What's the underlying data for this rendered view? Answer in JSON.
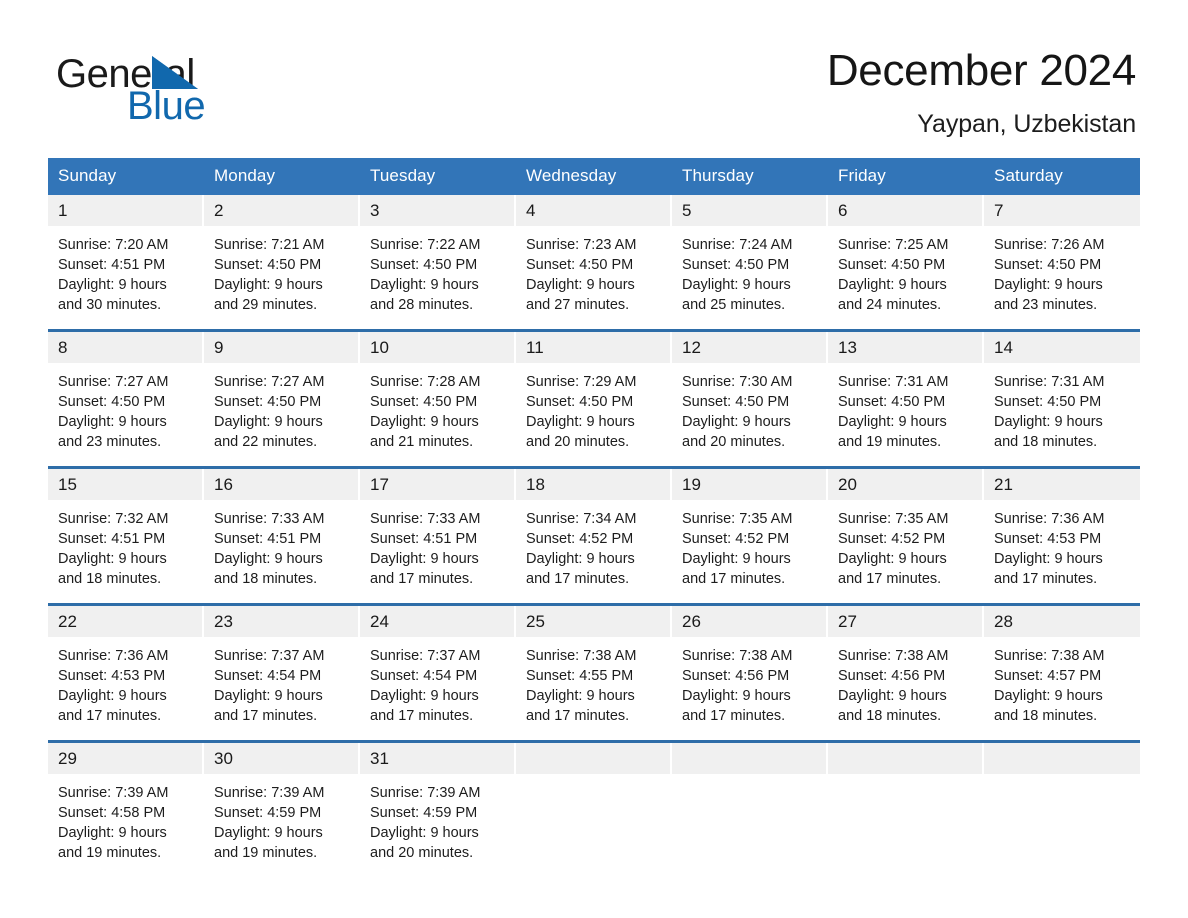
{
  "brand": {
    "name_part1": "General",
    "name_part2": "Blue",
    "triangle_color": "#1168ad",
    "accent_color": "#3275b8"
  },
  "header": {
    "month_title": "December 2024",
    "location": "Yaypan, Uzbekistan"
  },
  "calendar": {
    "weekday_headers": [
      "Sunday",
      "Monday",
      "Tuesday",
      "Wednesday",
      "Thursday",
      "Friday",
      "Saturday"
    ],
    "header_bg": "#3275b8",
    "row_divider_color": "#2e6da8",
    "day_band_bg": "#f0f0f0",
    "weeks": [
      [
        {
          "day": "1",
          "sunrise": "Sunrise: 7:20 AM",
          "sunset": "Sunset: 4:51 PM",
          "daylight_line1": "Daylight: 9 hours",
          "daylight_line2": "and 30 minutes."
        },
        {
          "day": "2",
          "sunrise": "Sunrise: 7:21 AM",
          "sunset": "Sunset: 4:50 PM",
          "daylight_line1": "Daylight: 9 hours",
          "daylight_line2": "and 29 minutes."
        },
        {
          "day": "3",
          "sunrise": "Sunrise: 7:22 AM",
          "sunset": "Sunset: 4:50 PM",
          "daylight_line1": "Daylight: 9 hours",
          "daylight_line2": "and 28 minutes."
        },
        {
          "day": "4",
          "sunrise": "Sunrise: 7:23 AM",
          "sunset": "Sunset: 4:50 PM",
          "daylight_line1": "Daylight: 9 hours",
          "daylight_line2": "and 27 minutes."
        },
        {
          "day": "5",
          "sunrise": "Sunrise: 7:24 AM",
          "sunset": "Sunset: 4:50 PM",
          "daylight_line1": "Daylight: 9 hours",
          "daylight_line2": "and 25 minutes."
        },
        {
          "day": "6",
          "sunrise": "Sunrise: 7:25 AM",
          "sunset": "Sunset: 4:50 PM",
          "daylight_line1": "Daylight: 9 hours",
          "daylight_line2": "and 24 minutes."
        },
        {
          "day": "7",
          "sunrise": "Sunrise: 7:26 AM",
          "sunset": "Sunset: 4:50 PM",
          "daylight_line1": "Daylight: 9 hours",
          "daylight_line2": "and 23 minutes."
        }
      ],
      [
        {
          "day": "8",
          "sunrise": "Sunrise: 7:27 AM",
          "sunset": "Sunset: 4:50 PM",
          "daylight_line1": "Daylight: 9 hours",
          "daylight_line2": "and 23 minutes."
        },
        {
          "day": "9",
          "sunrise": "Sunrise: 7:27 AM",
          "sunset": "Sunset: 4:50 PM",
          "daylight_line1": "Daylight: 9 hours",
          "daylight_line2": "and 22 minutes."
        },
        {
          "day": "10",
          "sunrise": "Sunrise: 7:28 AM",
          "sunset": "Sunset: 4:50 PM",
          "daylight_line1": "Daylight: 9 hours",
          "daylight_line2": "and 21 minutes."
        },
        {
          "day": "11",
          "sunrise": "Sunrise: 7:29 AM",
          "sunset": "Sunset: 4:50 PM",
          "daylight_line1": "Daylight: 9 hours",
          "daylight_line2": "and 20 minutes."
        },
        {
          "day": "12",
          "sunrise": "Sunrise: 7:30 AM",
          "sunset": "Sunset: 4:50 PM",
          "daylight_line1": "Daylight: 9 hours",
          "daylight_line2": "and 20 minutes."
        },
        {
          "day": "13",
          "sunrise": "Sunrise: 7:31 AM",
          "sunset": "Sunset: 4:50 PM",
          "daylight_line1": "Daylight: 9 hours",
          "daylight_line2": "and 19 minutes."
        },
        {
          "day": "14",
          "sunrise": "Sunrise: 7:31 AM",
          "sunset": "Sunset: 4:50 PM",
          "daylight_line1": "Daylight: 9 hours",
          "daylight_line2": "and 18 minutes."
        }
      ],
      [
        {
          "day": "15",
          "sunrise": "Sunrise: 7:32 AM",
          "sunset": "Sunset: 4:51 PM",
          "daylight_line1": "Daylight: 9 hours",
          "daylight_line2": "and 18 minutes."
        },
        {
          "day": "16",
          "sunrise": "Sunrise: 7:33 AM",
          "sunset": "Sunset: 4:51 PM",
          "daylight_line1": "Daylight: 9 hours",
          "daylight_line2": "and 18 minutes."
        },
        {
          "day": "17",
          "sunrise": "Sunrise: 7:33 AM",
          "sunset": "Sunset: 4:51 PM",
          "daylight_line1": "Daylight: 9 hours",
          "daylight_line2": "and 17 minutes."
        },
        {
          "day": "18",
          "sunrise": "Sunrise: 7:34 AM",
          "sunset": "Sunset: 4:52 PM",
          "daylight_line1": "Daylight: 9 hours",
          "daylight_line2": "and 17 minutes."
        },
        {
          "day": "19",
          "sunrise": "Sunrise: 7:35 AM",
          "sunset": "Sunset: 4:52 PM",
          "daylight_line1": "Daylight: 9 hours",
          "daylight_line2": "and 17 minutes."
        },
        {
          "day": "20",
          "sunrise": "Sunrise: 7:35 AM",
          "sunset": "Sunset: 4:52 PM",
          "daylight_line1": "Daylight: 9 hours",
          "daylight_line2": "and 17 minutes."
        },
        {
          "day": "21",
          "sunrise": "Sunrise: 7:36 AM",
          "sunset": "Sunset: 4:53 PM",
          "daylight_line1": "Daylight: 9 hours",
          "daylight_line2": "and 17 minutes."
        }
      ],
      [
        {
          "day": "22",
          "sunrise": "Sunrise: 7:36 AM",
          "sunset": "Sunset: 4:53 PM",
          "daylight_line1": "Daylight: 9 hours",
          "daylight_line2": "and 17 minutes."
        },
        {
          "day": "23",
          "sunrise": "Sunrise: 7:37 AM",
          "sunset": "Sunset: 4:54 PM",
          "daylight_line1": "Daylight: 9 hours",
          "daylight_line2": "and 17 minutes."
        },
        {
          "day": "24",
          "sunrise": "Sunrise: 7:37 AM",
          "sunset": "Sunset: 4:54 PM",
          "daylight_line1": "Daylight: 9 hours",
          "daylight_line2": "and 17 minutes."
        },
        {
          "day": "25",
          "sunrise": "Sunrise: 7:38 AM",
          "sunset": "Sunset: 4:55 PM",
          "daylight_line1": "Daylight: 9 hours",
          "daylight_line2": "and 17 minutes."
        },
        {
          "day": "26",
          "sunrise": "Sunrise: 7:38 AM",
          "sunset": "Sunset: 4:56 PM",
          "daylight_line1": "Daylight: 9 hours",
          "daylight_line2": "and 17 minutes."
        },
        {
          "day": "27",
          "sunrise": "Sunrise: 7:38 AM",
          "sunset": "Sunset: 4:56 PM",
          "daylight_line1": "Daylight: 9 hours",
          "daylight_line2": "and 18 minutes."
        },
        {
          "day": "28",
          "sunrise": "Sunrise: 7:38 AM",
          "sunset": "Sunset: 4:57 PM",
          "daylight_line1": "Daylight: 9 hours",
          "daylight_line2": "and 18 minutes."
        }
      ],
      [
        {
          "day": "29",
          "sunrise": "Sunrise: 7:39 AM",
          "sunset": "Sunset: 4:58 PM",
          "daylight_line1": "Daylight: 9 hours",
          "daylight_line2": "and 19 minutes."
        },
        {
          "day": "30",
          "sunrise": "Sunrise: 7:39 AM",
          "sunset": "Sunset: 4:59 PM",
          "daylight_line1": "Daylight: 9 hours",
          "daylight_line2": "and 19 minutes."
        },
        {
          "day": "31",
          "sunrise": "Sunrise: 7:39 AM",
          "sunset": "Sunset: 4:59 PM",
          "daylight_line1": "Daylight: 9 hours",
          "daylight_line2": "and 20 minutes."
        },
        {
          "day": "",
          "sunrise": "",
          "sunset": "",
          "daylight_line1": "",
          "daylight_line2": ""
        },
        {
          "day": "",
          "sunrise": "",
          "sunset": "",
          "daylight_line1": "",
          "daylight_line2": ""
        },
        {
          "day": "",
          "sunrise": "",
          "sunset": "",
          "daylight_line1": "",
          "daylight_line2": ""
        },
        {
          "day": "",
          "sunrise": "",
          "sunset": "",
          "daylight_line1": "",
          "daylight_line2": ""
        }
      ]
    ]
  }
}
